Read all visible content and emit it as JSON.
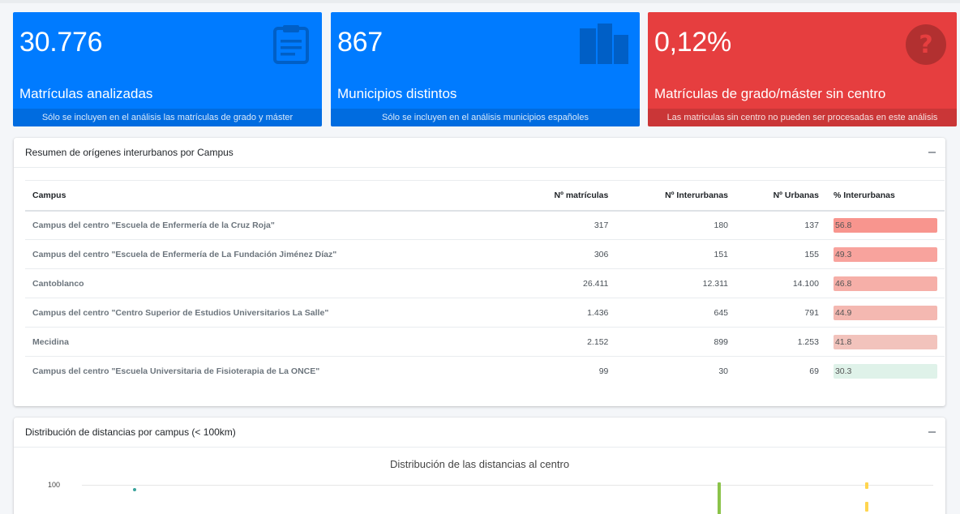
{
  "stats": [
    {
      "value": "30.776",
      "label": "Matrículas analizadas",
      "note": "Sólo se incluyen en el análisis las matrículas de grado y máster",
      "icon": "clipboard-icon",
      "color": "#007bff"
    },
    {
      "value": "867",
      "label": "Municipios distintos",
      "note": "Sólo se incluyen en el análisis municipios españoles",
      "icon": "city-icon",
      "color": "#007bff"
    },
    {
      "value": "0,12%",
      "label": "Matrículas de grado/máster sin centro",
      "note": "Las matriculas sin centro no pueden ser procesadas en este análisis",
      "icon": "question-icon",
      "color": "#e63e3f"
    }
  ],
  "summary": {
    "title": "Resumen de orígenes interurbanos por Campus",
    "columns": [
      "Campus",
      "Nº matrículas",
      "Nº Interurbanas",
      "Nº Urbanas",
      "% Interurbanas"
    ],
    "rows": [
      {
        "campus": "Campus del centro \"Escuela de Enfermería de la Cruz Roja\"",
        "matriculas": "317",
        "interurbanas": "180",
        "urbanas": "137",
        "pct": "56.8",
        "pct_value": 56.8,
        "color": "#f8958e"
      },
      {
        "campus": "Campus del centro \"Escuela de Enfermería de La Fundación Jiménez Díaz\"",
        "matriculas": "306",
        "interurbanas": "151",
        "urbanas": "155",
        "pct": "49.3",
        "pct_value": 49.3,
        "color": "#f8a39d"
      },
      {
        "campus": "Cantoblanco",
        "matriculas": "26.411",
        "interurbanas": "12.311",
        "urbanas": "14.100",
        "pct": "46.8",
        "pct_value": 46.8,
        "color": "#f6afa8"
      },
      {
        "campus": "Campus del centro \"Centro Superior de Estudios Universitarios La Salle\"",
        "matriculas": "1.436",
        "interurbanas": "645",
        "urbanas": "791",
        "pct": "44.9",
        "pct_value": 44.9,
        "color": "#f4b8b1"
      },
      {
        "campus": "Mecidina",
        "matriculas": "2.152",
        "interurbanas": "899",
        "urbanas": "1.253",
        "pct": "41.8",
        "pct_value": 41.8,
        "color": "#f2c3bc"
      },
      {
        "campus": "Campus del centro \"Escuela Universitaria de Fisioterapia de La ONCE\"",
        "matriculas": "99",
        "interurbanas": "30",
        "urbanas": "69",
        "pct": "30.3",
        "pct_value": 30.3,
        "color": "#dff2e9"
      }
    ]
  },
  "distances": {
    "title": "Distribución de distancias por campus (< 100km)",
    "chart_data": {
      "type": "scatter",
      "title": "Distribución de las distancias al centro",
      "y_ticks": [
        "100"
      ],
      "colors": {
        "teal": "#3aa39b",
        "green": "#8bc34a",
        "yellow": "#ffd54f"
      }
    }
  }
}
